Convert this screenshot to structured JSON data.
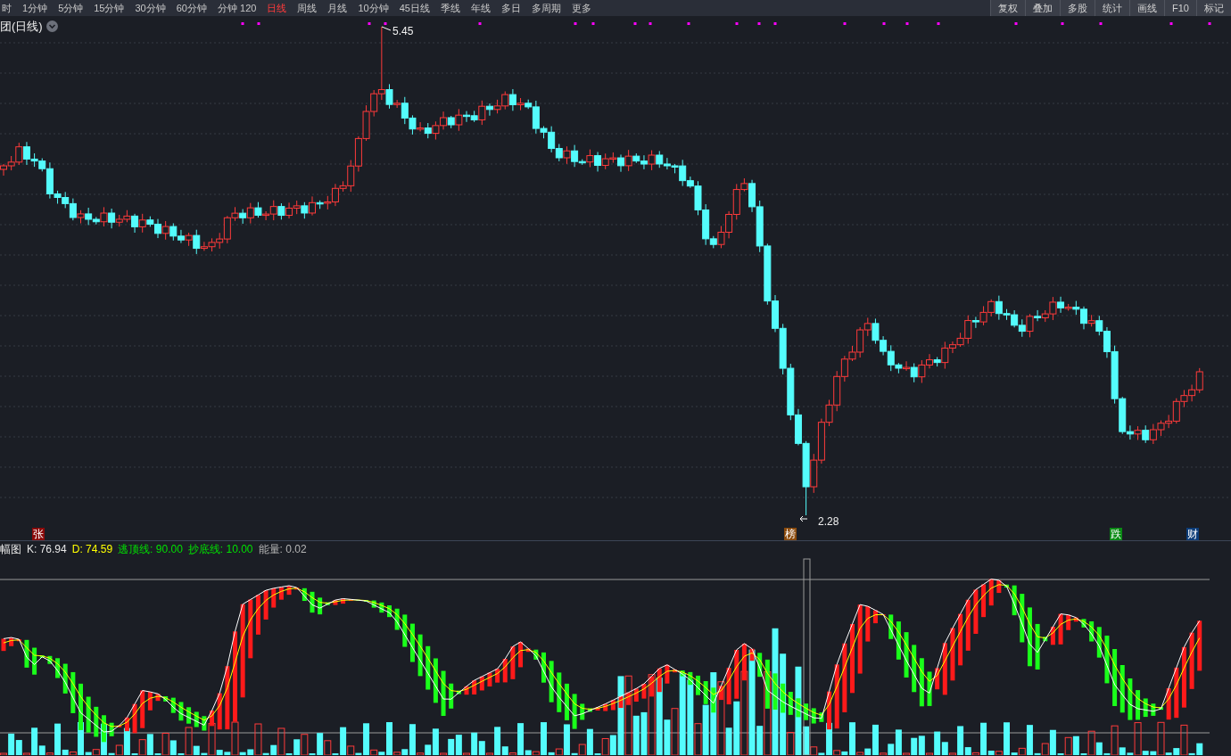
{
  "periods": [
    {
      "label": "时",
      "selected": false
    },
    {
      "label": "1分钟",
      "selected": false
    },
    {
      "label": "5分钟",
      "selected": false
    },
    {
      "label": "15分钟",
      "selected": false
    },
    {
      "label": "30分钟",
      "selected": false
    },
    {
      "label": "60分钟",
      "selected": false
    },
    {
      "label": "分钟 120",
      "selected": false
    },
    {
      "label": "日线",
      "selected": true
    },
    {
      "label": "周线",
      "selected": false
    },
    {
      "label": "月线",
      "selected": false
    },
    {
      "label": "10分钟",
      "selected": false
    },
    {
      "label": "45日线",
      "selected": false
    },
    {
      "label": "季线",
      "selected": false
    },
    {
      "label": "年线",
      "selected": false
    },
    {
      "label": "多日",
      "selected": false
    },
    {
      "label": "多周期",
      "selected": false
    },
    {
      "label": "更多",
      "selected": false
    }
  ],
  "tools": [
    "复权",
    "叠加",
    "多股",
    "统计",
    "画线",
    "F10",
    "标记"
  ],
  "main_chart": {
    "title": "团(日线)",
    "high_label": "5.45",
    "low_label": "2.28",
    "markers": [
      {
        "text": "张",
        "color": "#8b0a0a"
      },
      {
        "text": "榜",
        "color": "#8a4a0c"
      },
      {
        "text": "跌",
        "color": "#0a8a14"
      },
      {
        "text": "财",
        "color": "#0c3c78"
      }
    ]
  },
  "indicator": {
    "name": "幅图",
    "legend": [
      {
        "label": "K:",
        "value": "76.94",
        "color": "#e6e6e6"
      },
      {
        "label": "D:",
        "value": "74.59",
        "color": "#ffff00"
      },
      {
        "label": "逃顶线:",
        "value": "90.00",
        "color": "#00e000"
      },
      {
        "label": "抄底线:",
        "value": "10.00",
        "color": "#00e000"
      },
      {
        "label": "能量:",
        "value": "0.02",
        "color": "#b4b4b4"
      }
    ]
  }
}
